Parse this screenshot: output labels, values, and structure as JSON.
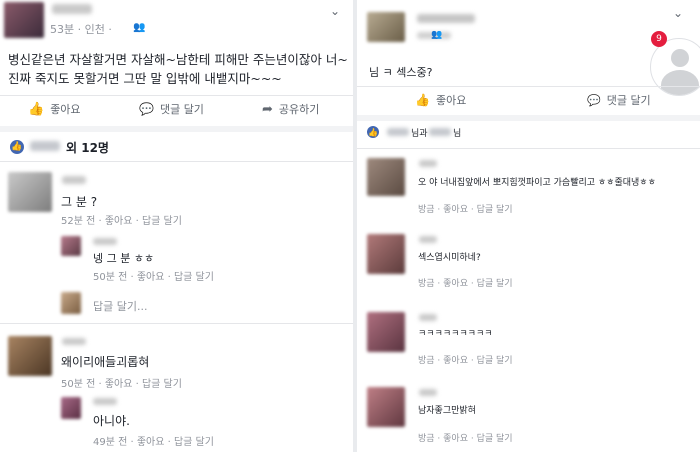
{
  "left": {
    "post": {
      "time_location": "53분 · 인천 ·",
      "body_line1": "병신같은년 자살할거면 자살해~남한테 피해만 주는년이잖아 너~",
      "body_line2": "진짜 죽지도 못할거면 그딴 말 입밖에 내뱉지마~~~",
      "like_label": "좋아요",
      "comment_label": "댓글 달기",
      "share_label": "공유하기"
    },
    "reactions": {
      "count_text": "외 12명"
    },
    "comments": [
      {
        "text": "그 분 ?",
        "meta": "52분 전 · 좋아요 · 답글 달기"
      },
      {
        "text": "넹 그 분 ㅎㅎ",
        "meta": "50분 전 · 좋아요 · 답글 달기"
      },
      {
        "text": "답글 달기...",
        "meta": ""
      },
      {
        "text": "왜이리애들괴롭혀",
        "meta": "50분 전 · 좋아요 · 답글 달기"
      },
      {
        "text": "아니야.",
        "meta": "49분 전 · 좋아요 · 답글 달기"
      }
    ]
  },
  "right": {
    "post": {
      "body": "님 ㅋ 섹스중?",
      "like_label": "좋아요",
      "comment_label": "댓글 달기",
      "notif_count": "9"
    },
    "reactions": {
      "names_suffix": "님과",
      "names_suffix2": "님"
    },
    "comments": [
      {
        "text": "오   야 너내집앞에서 뽀지힘껏파이고 가슴빨리고 ㅎㅎ줄대냉ㅎㅎ",
        "meta": "방금 · 좋아요 · 답글 달기"
      },
      {
        "text": "섹스엽시미하네?",
        "meta": "방금 · 좋아요 · 답글 달기"
      },
      {
        "text": "ㅋㅋㅋㅋㅋㅋㅋㅋㅋ",
        "meta": "방금 · 좋아요 · 답글 달기"
      },
      {
        "text": "남자좋그만밝혀",
        "meta": "방금 · 좋아요 · 답글 달기"
      }
    ]
  },
  "colors": {
    "accent": "#4267b2",
    "badge": "#e41e3f"
  }
}
